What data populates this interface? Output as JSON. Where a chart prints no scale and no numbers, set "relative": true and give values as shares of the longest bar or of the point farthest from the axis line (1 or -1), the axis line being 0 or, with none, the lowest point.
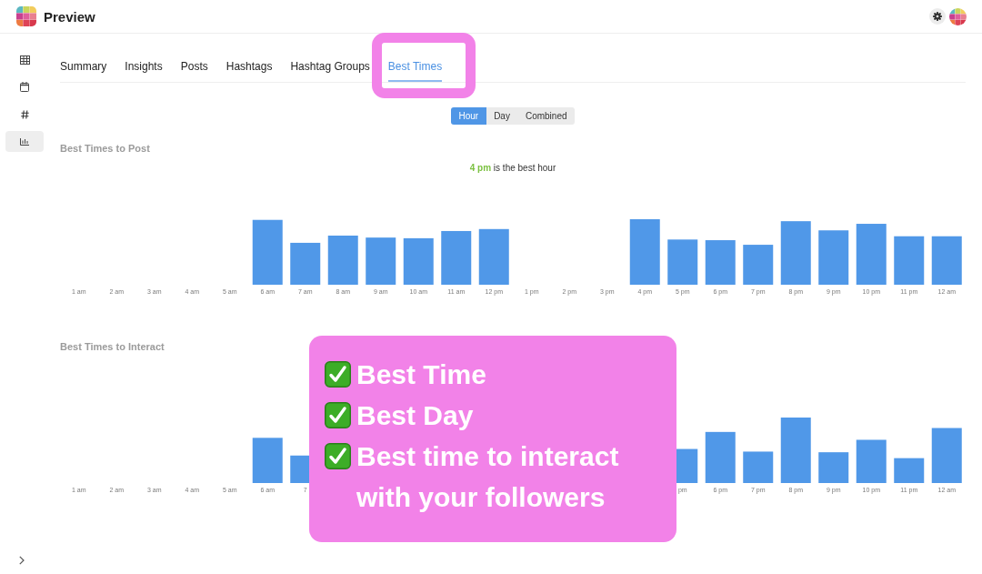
{
  "header": {
    "title": "Preview"
  },
  "sidebar": {
    "items": [
      {
        "kind": "table",
        "selected": false
      },
      {
        "kind": "calendar",
        "selected": false
      },
      {
        "kind": "hashtag",
        "selected": false
      },
      {
        "kind": "chart",
        "selected": true
      }
    ]
  },
  "tabs": [
    {
      "label": "Summary",
      "selected": false,
      "highlighted": false
    },
    {
      "label": "Insights",
      "selected": false,
      "highlighted": false
    },
    {
      "label": "Posts",
      "selected": false,
      "highlighted": false
    },
    {
      "label": "Hashtags",
      "selected": false,
      "highlighted": false
    },
    {
      "label": "Hashtag Groups",
      "selected": false,
      "highlighted": false
    },
    {
      "label": "Best Times",
      "selected": true,
      "highlighted": true
    }
  ],
  "view_toggle": [
    {
      "label": "Hour",
      "selected": true
    },
    {
      "label": "Day",
      "selected": false
    },
    {
      "label": "Combined",
      "selected": false
    }
  ],
  "sections": [
    {
      "summary": "**4 pm** is the best hour",
      "chart_data": {
        "type": "bar",
        "title": "Best Times to Post",
        "relative": true,
        "categories": [
          "1 am",
          "2 am",
          "3 am",
          "4 am",
          "5 am",
          "6 am",
          "7 am",
          "8 am",
          "9 am",
          "10 am",
          "11 am",
          "12 pm",
          "1 pm",
          "2 pm",
          "3 pm",
          "4 pm",
          "5 pm",
          "6 pm",
          "7 pm",
          "8 pm",
          "9 pm",
          "10 pm",
          "11 pm",
          "12 am"
        ],
        "values": [
          0,
          0,
          0,
          0,
          0,
          0.99,
          0.64,
          0.75,
          0.72,
          0.71,
          0.82,
          0.85,
          0,
          0,
          0,
          1,
          0.69,
          0.68,
          0.61,
          0.97,
          0.83,
          0.93,
          0.74,
          0.74
        ]
      }
    },
    {
      "chart_data": {
        "type": "bar",
        "title": "Best Times to Interact",
        "relative": true,
        "categories": [
          "1 am",
          "2 am",
          "3 am",
          "4 am",
          "5 am",
          "6 am",
          "7",
          null,
          null,
          null,
          null,
          null,
          null,
          null,
          null,
          null,
          "pm",
          "6 pm",
          "7 pm",
          "8 pm",
          "9 pm",
          "10 pm",
          "11 pm",
          "12 am"
        ],
        "values": [
          0,
          0,
          0,
          0,
          0,
          0.69,
          0.42,
          null,
          null,
          null,
          null,
          null,
          null,
          null,
          null,
          null,
          0.52,
          0.78,
          0.48,
          1,
          0.47,
          0.66,
          0.38,
          0.84
        ]
      }
    }
  ],
  "promo": {
    "items": [
      {
        "label": "Best Time"
      },
      {
        "label": "Best Day"
      },
      {
        "label": "Best time to interact with your followers"
      }
    ]
  }
}
